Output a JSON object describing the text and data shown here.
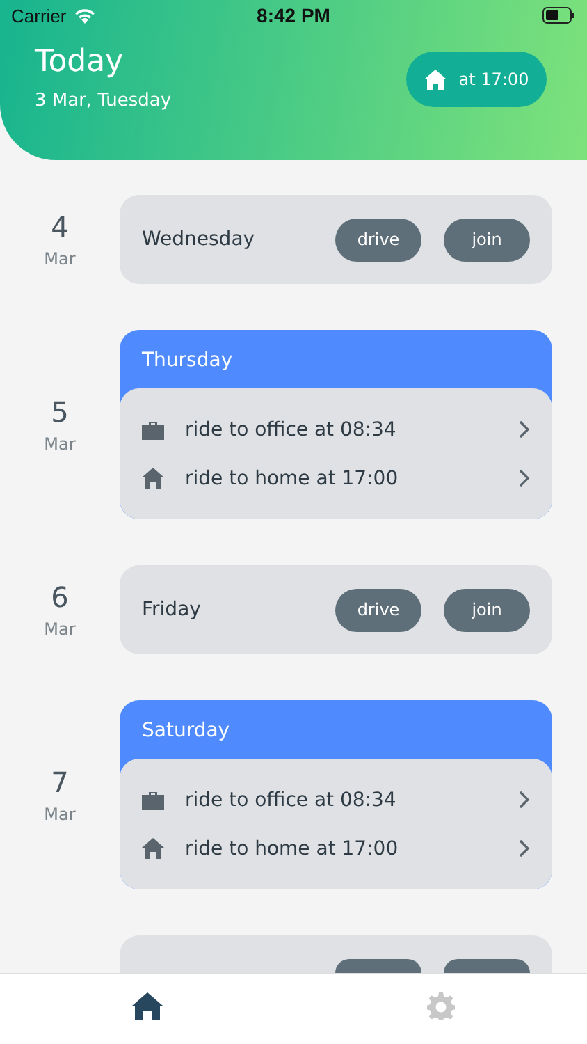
{
  "status_bar": {
    "carrier": "Carrier",
    "time": "8:42 PM"
  },
  "header": {
    "title": "Today",
    "date": "3 Mar, Tuesday",
    "button": "at 17:00"
  },
  "days": [
    {
      "kind": "simple",
      "day": "4",
      "month": "Mar",
      "weekday": "Wednesday",
      "actions": [
        "drive",
        "join"
      ]
    },
    {
      "kind": "rides",
      "day": "5",
      "month": "Mar",
      "weekday": "Thursday",
      "rides": [
        {
          "kind": "office",
          "label": "ride to office at 08:34"
        },
        {
          "kind": "home",
          "label": "ride to home at 17:00"
        }
      ]
    },
    {
      "kind": "simple",
      "day": "6",
      "month": "Mar",
      "weekday": "Friday",
      "actions": [
        "drive",
        "join"
      ]
    },
    {
      "kind": "rides",
      "day": "7",
      "month": "Mar",
      "weekday": "Saturday",
      "rides": [
        {
          "kind": "office",
          "label": "ride to office at 08:34"
        },
        {
          "kind": "home",
          "label": "ride to home at 17:00"
        }
      ]
    },
    {
      "kind": "partial"
    }
  ],
  "tabs": [
    {
      "kind": "home",
      "selected": true
    },
    {
      "kind": "settings",
      "selected": false
    }
  ]
}
